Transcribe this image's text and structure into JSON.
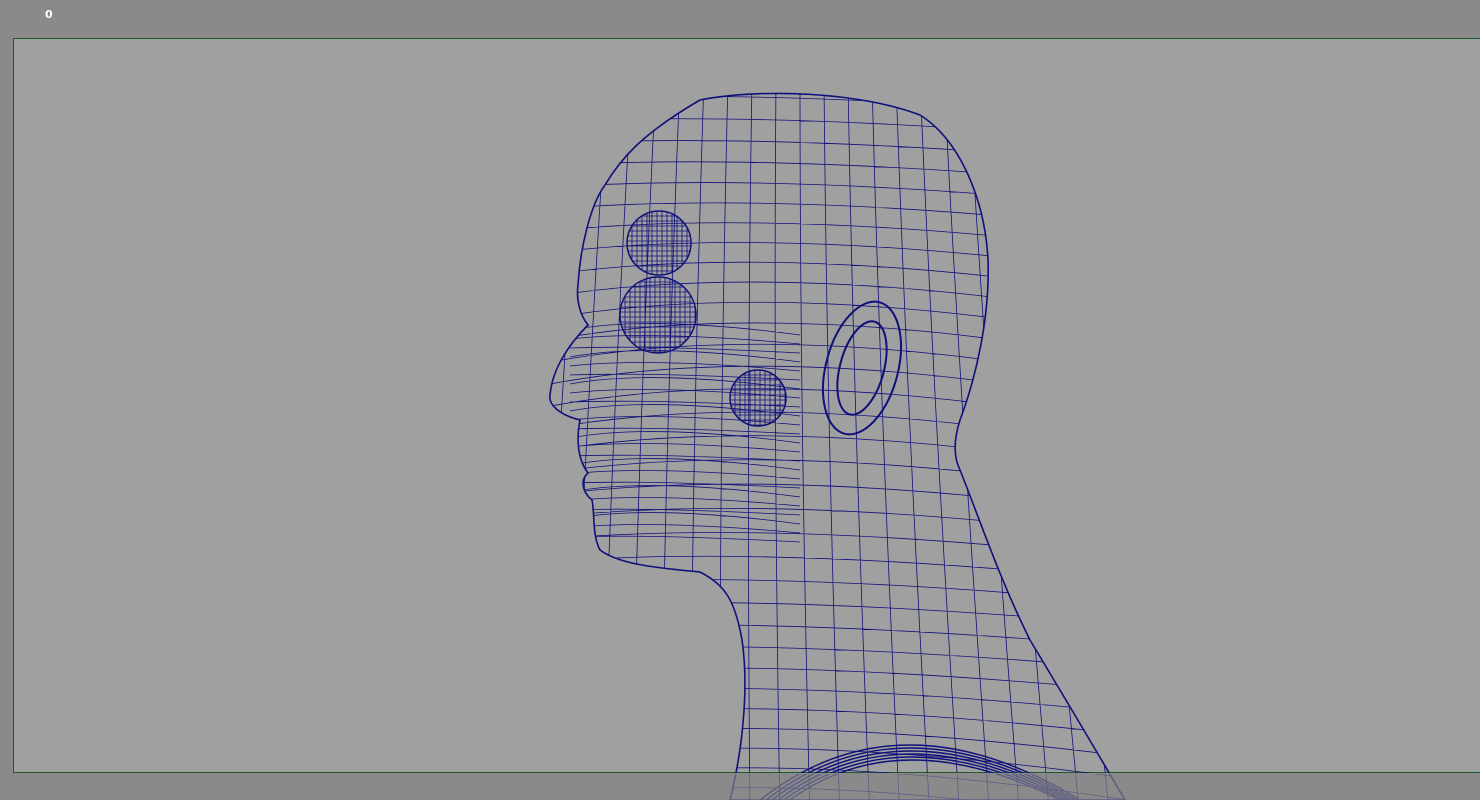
{
  "hud": {
    "frame_counter": "0"
  },
  "colors": {
    "wire": "#10107a",
    "viewport_bg": "#a0a0a0",
    "outer_bg": "#8a8a8a",
    "gate": "#1f5a2e"
  }
}
